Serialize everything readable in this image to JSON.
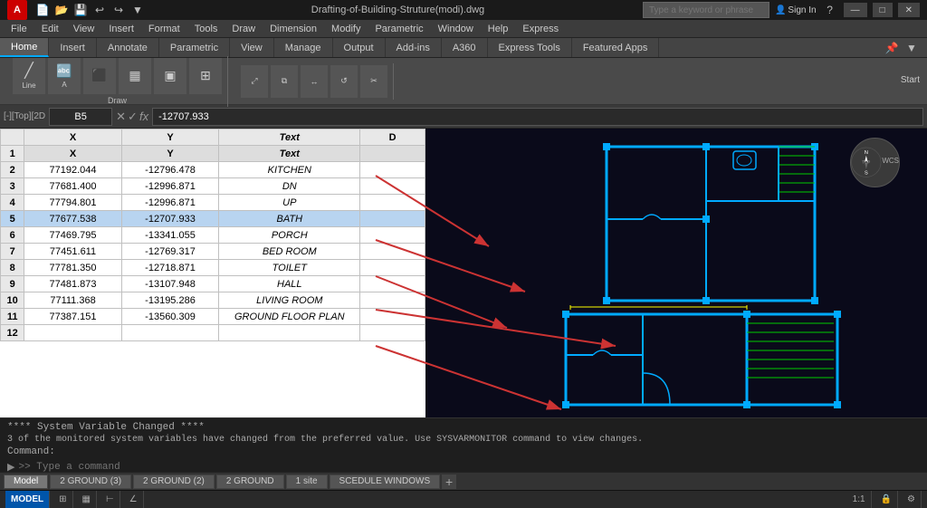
{
  "titlebar": {
    "title": "Drafting-of-Building-Struture(modi).dwg",
    "search_placeholder": "Type a keyword or phrase",
    "sign_in": "Sign In",
    "help": "?",
    "minimize": "—",
    "maximize": "□",
    "close": "✕"
  },
  "menubar": {
    "items": [
      "A",
      "File",
      "Edit",
      "View",
      "Insert",
      "Format",
      "Tools",
      "Draw",
      "Dimension",
      "Modify",
      "Parametric",
      "Window",
      "Help",
      "Express"
    ]
  },
  "ribbon": {
    "tabs": [
      "Home",
      "Insert",
      "Annotate",
      "Parametric",
      "View",
      "Manage",
      "Output",
      "Add-ins",
      "A360",
      "Express Tools",
      "Featured Apps"
    ],
    "active_tab": "Home"
  },
  "toolbar": {
    "draw_label": "Draw",
    "start_label": "Start"
  },
  "formulabar": {
    "cell_ref": "B5",
    "formula_value": "-12707.933"
  },
  "spreadsheet": {
    "headers": [
      "",
      "X",
      "Y",
      "Text",
      "D"
    ],
    "rows": [
      {
        "row": 1,
        "x": "X",
        "y": "Y",
        "text": "Text",
        "d": "",
        "bold": true
      },
      {
        "row": 2,
        "x": "77192.044",
        "y": "-12796.478",
        "text": "KITCHEN",
        "d": ""
      },
      {
        "row": 3,
        "x": "77681.400",
        "y": "-12996.871",
        "text": "DN",
        "d": ""
      },
      {
        "row": 4,
        "x": "77794.801",
        "y": "-12996.871",
        "text": "UP",
        "d": ""
      },
      {
        "row": 5,
        "x": "77677.538",
        "y": "-12707.933",
        "text": "BATH",
        "d": "",
        "selected": true
      },
      {
        "row": 6,
        "x": "77469.795",
        "y": "-13341.055",
        "text": "PORCH",
        "d": ""
      },
      {
        "row": 7,
        "x": "77451.611",
        "y": "-12769.317",
        "text": "BED ROOM",
        "d": ""
      },
      {
        "row": 8,
        "x": "77781.350",
        "y": "-12718.871",
        "text": "TOILET",
        "d": ""
      },
      {
        "row": 9,
        "x": "77481.873",
        "y": "-13107.948",
        "text": "HALL",
        "d": ""
      },
      {
        "row": 10,
        "x": "77111.368",
        "y": "-13195.286",
        "text": "LIVING ROOM",
        "d": ""
      },
      {
        "row": 11,
        "x": "77387.151",
        "y": "-13560.309",
        "text": "GROUND FLOOR PLAN",
        "d": ""
      },
      {
        "row": 12,
        "x": "",
        "y": "",
        "text": "",
        "d": ""
      }
    ]
  },
  "command_area": {
    "line1": "**** System Variable Changed ****",
    "line2": "3 of the monitored system variables have changed from the preferred value. Use SYSVARMONITOR command to view changes.",
    "line3": "Command:",
    "prompt": ">> Type a command"
  },
  "statusbar": {
    "model": "MODEL",
    "tabs": [
      "Model",
      "2 GROUND (3)",
      "2 GROUND (2)",
      "2 GROUND",
      "1 site",
      "SCEDULE WINDOWS"
    ],
    "active_tab": "Model",
    "right_items": [
      "MODEL",
      "1:1"
    ]
  },
  "compass": {
    "n": "N",
    "s": "S",
    "top": "TOP",
    "wcs": "WCS"
  },
  "colors": {
    "cad_bg": "#0a0a1a",
    "cad_wall": "#00aaff",
    "cad_green": "#00cc00",
    "arrow_color": "#cc0000"
  }
}
